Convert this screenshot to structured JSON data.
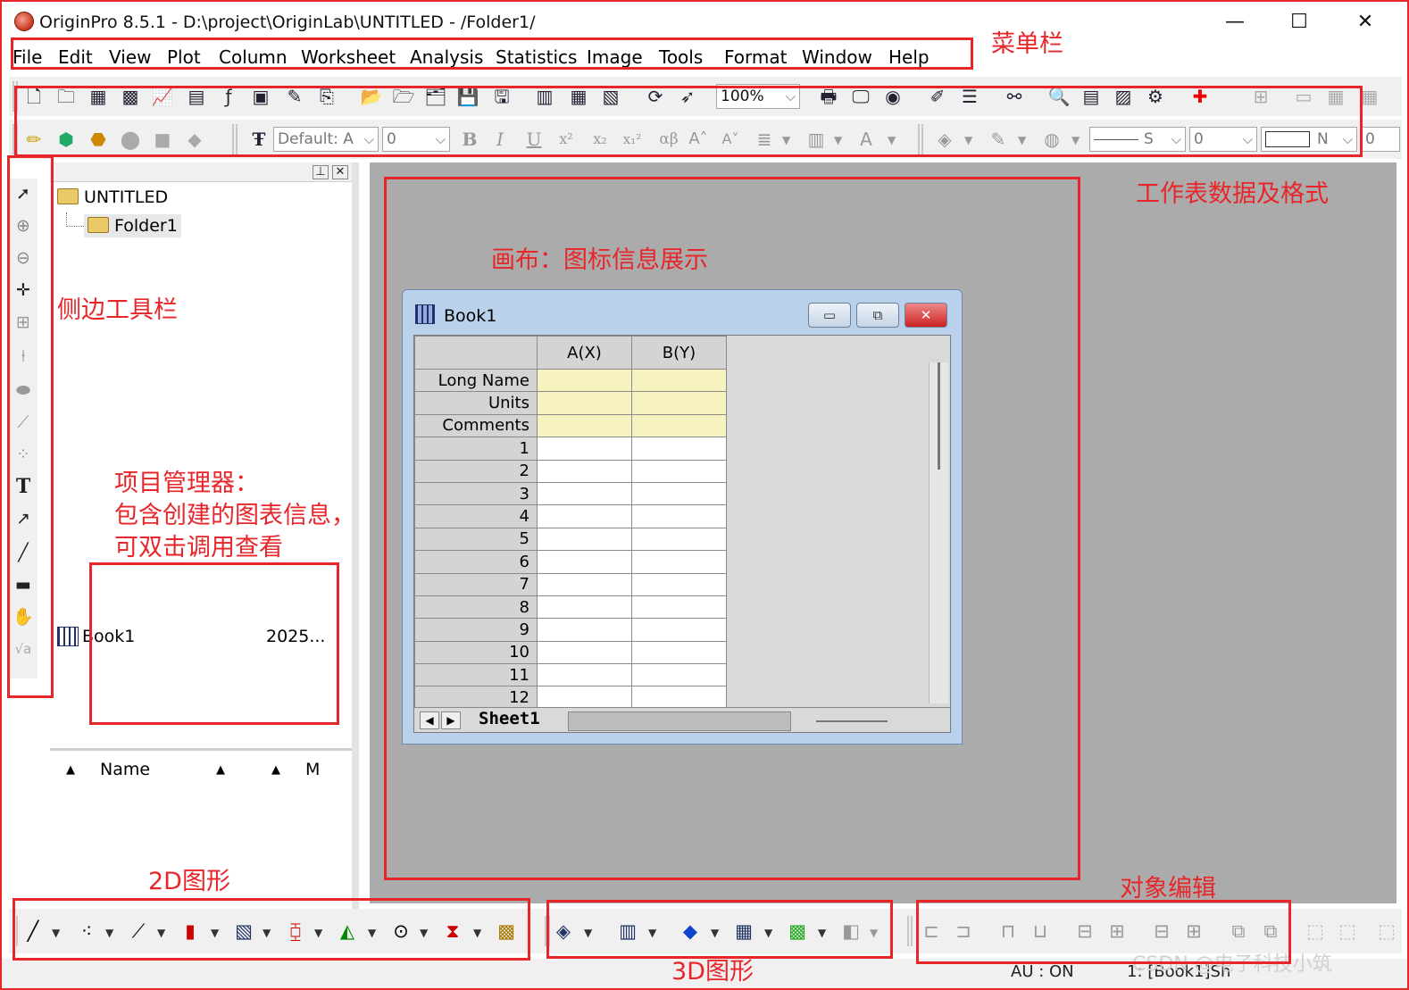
{
  "window": {
    "title": "OriginPro 8.5.1 - D:\\project\\OriginLab\\UNTITLED - /Folder1/",
    "minimize_glyph": "—",
    "maximize_glyph": "☐",
    "close_glyph": "✕"
  },
  "menu": [
    "File",
    "Edit",
    "View",
    "Plot",
    "Column",
    "Worksheet",
    "Analysis",
    "Statistics",
    "Image",
    "Tools",
    "Format",
    "Window",
    "Help"
  ],
  "toolbar": {
    "zoom": "100%",
    "font": "Default: A",
    "font_size": "0",
    "line_style": "S",
    "line_width": "0",
    "fill_label": "N",
    "extra_value": "0",
    "bold": "B",
    "italic": "I",
    "underline": "U",
    "superscript": "x²",
    "subscript": "x₂",
    "supsub": "x₁²",
    "greek": "αβ",
    "increase_font": "A˄",
    "decrease_font": "A˅"
  },
  "sidebar_icons": [
    "pointer-icon",
    "zoom-in-icon",
    "zoom-out-icon",
    "screen-reader-icon",
    "data-selector-icon",
    "data-reader-icon",
    "regional-mask-icon",
    "draw-data-icon",
    "scatter-icon",
    "text-tool-icon",
    "arrow-tool-icon",
    "line-tool-icon",
    "rectangle-tool-icon",
    "hand-icon",
    "formula-icon"
  ],
  "sidebar_text_label": "T",
  "project_explorer": {
    "root": "UNTITLED",
    "folder": "Folder1",
    "columns": {
      "name": "Name",
      "modified": "M"
    },
    "items": [
      {
        "name": "Book1",
        "date": "2025..."
      }
    ]
  },
  "book": {
    "title": "Book1",
    "columns": [
      "A(X)",
      "B(Y)"
    ],
    "header_rows": [
      "Long Name",
      "Units",
      "Comments"
    ],
    "rows": [
      "1",
      "2",
      "3",
      "4",
      "5",
      "6",
      "7",
      "8",
      "9",
      "10",
      "11",
      "12"
    ],
    "sheet_tab": "Sheet1"
  },
  "status": {
    "au": "AU : ON",
    "active": "1: [Book1]Sh"
  },
  "annotations": {
    "menu_bar": "菜单栏",
    "worksheet_format": "工作表数据及格式",
    "canvas": "画布：图标信息展示",
    "side_toolbar": "侧边工具栏",
    "project_manager_1": "项目管理器：",
    "project_manager_2": "包含创建的图表信息，",
    "project_manager_3": "可双击调用查看",
    "graph_2d": "2D图形",
    "graph_3d": "3D图形",
    "object_edit": "对象编辑"
  },
  "watermark": "CSDN @电子科技小筑",
  "colors": {
    "annotation_red": "#e8262a",
    "workspace_gray": "#ababab",
    "book_frame": "#b9d1ea",
    "header_yellow": "#f7f3c0"
  }
}
